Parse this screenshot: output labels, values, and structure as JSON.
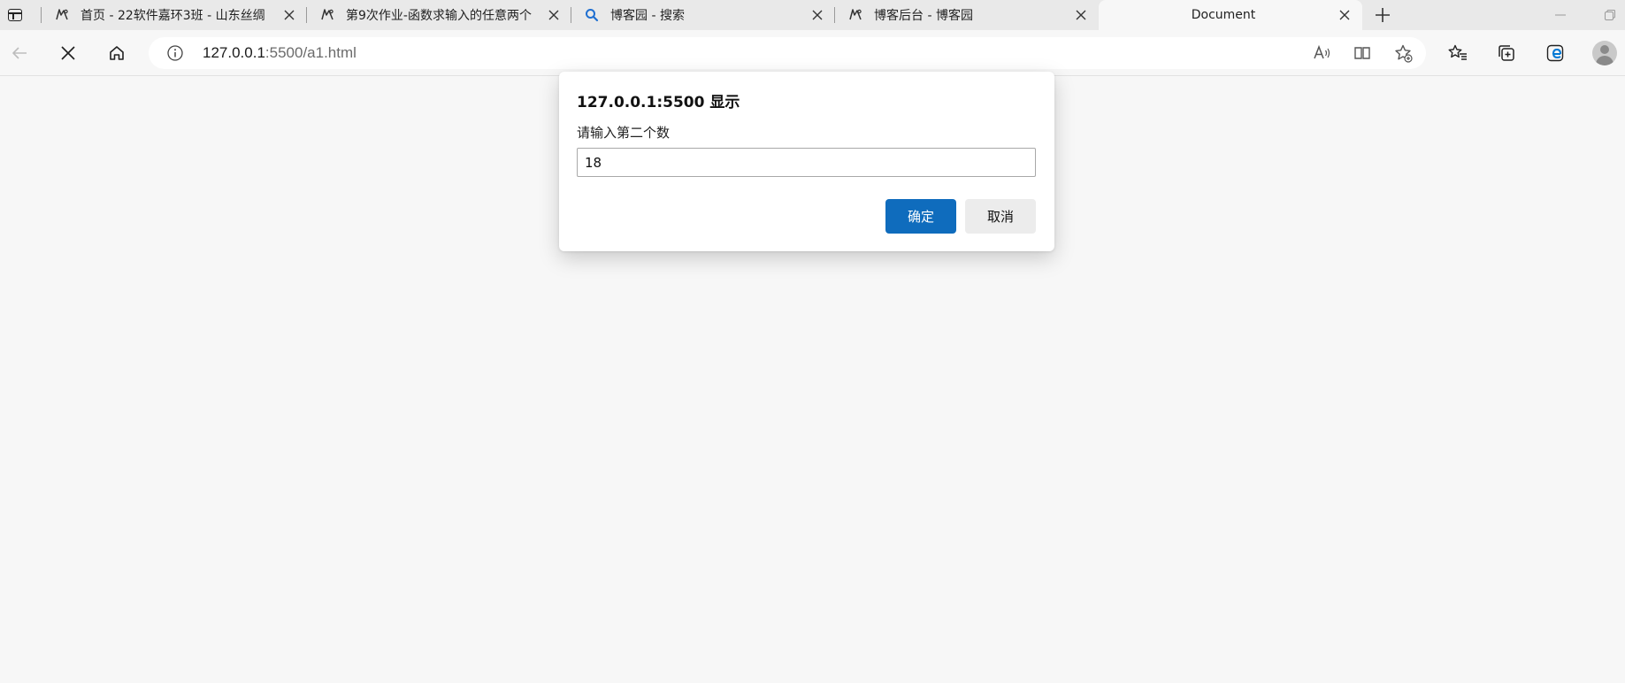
{
  "tabs": [
    {
      "title": "首页 - 22软件嘉环3班 - 山东丝绸",
      "favicon": "cnblogs-icon"
    },
    {
      "title": "第9次作业-函数求输入的任意两个",
      "favicon": "cnblogs-icon"
    },
    {
      "title": "博客园 - 搜索",
      "favicon": "search-icon"
    },
    {
      "title": "博客后台 - 博客园",
      "favicon": "cnblogs-icon"
    },
    {
      "title": "Document",
      "favicon": "",
      "active": true
    }
  ],
  "address_bar": {
    "url_host": "127.0.0.1",
    "url_rest": ":5500/a1.html"
  },
  "dialog": {
    "title": "127.0.0.1:5500 显示",
    "message": "请输入第二个数",
    "input_value": "18",
    "ok_label": "确定",
    "cancel_label": "取消"
  },
  "colors": {
    "accent": "#0f6cbd",
    "tabstrip_bg": "#e9e9e9",
    "page_bg": "#f7f7f7"
  }
}
